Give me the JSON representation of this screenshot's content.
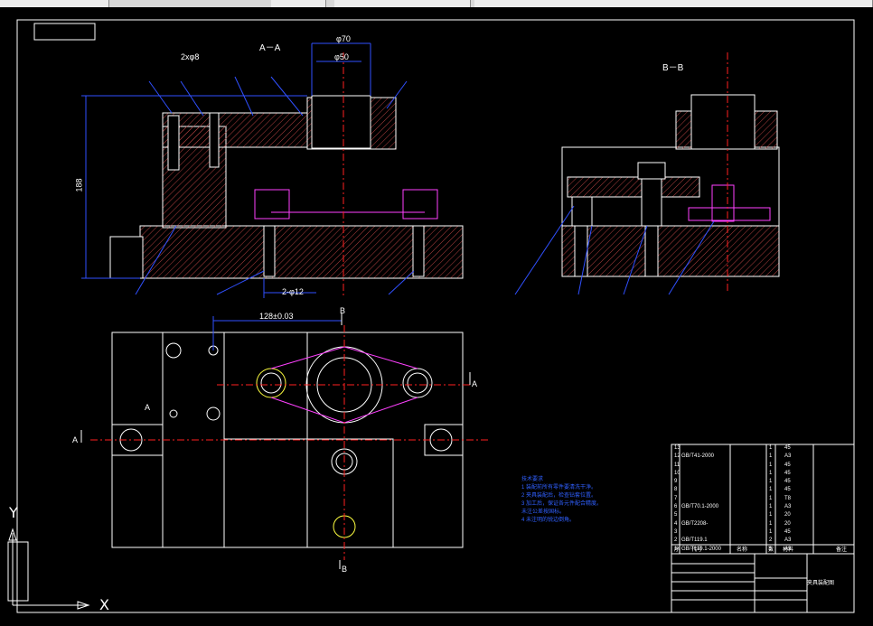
{
  "toolbar": {
    "present": true
  },
  "drawing": {
    "section_AA_label": "A－A",
    "section_BB_label": "B－B",
    "dim_phi70": "φ70",
    "dim_phi50": "φ50",
    "dim_holes": "2xφ8",
    "dim_height": "188",
    "dim_bottom": "2-φ12",
    "dim_spacing": "128±0.03",
    "mark_B_top": "B",
    "mark_B_bottom": "B",
    "mark_A_left": "A",
    "mark_A_right": "A",
    "mark_A_small": "A",
    "ucs_x": "X",
    "ucs_y": "Y"
  },
  "tech_notes": [
    "技术要求",
    "1  装配前所有零件要清洗干净。",
    "2  夹具装配后，检查钻套位置。",
    "3  加工后，保证各元件配合精度。",
    "   未注公差按国标。",
    "4  未注明的锐边倒角。"
  ],
  "parts_list": [
    {
      "no": "13",
      "code": "",
      "name": "",
      "qty": "1",
      "material": "45"
    },
    {
      "no": "12",
      "code": "GB/T41-2000",
      "name": "",
      "qty": "1",
      "material": "A3"
    },
    {
      "no": "11",
      "code": "",
      "name": "",
      "qty": "1",
      "material": "45"
    },
    {
      "no": "10",
      "code": "",
      "name": "",
      "qty": "1",
      "material": "45"
    },
    {
      "no": "9",
      "code": "",
      "name": "",
      "qty": "1",
      "material": "45"
    },
    {
      "no": "8",
      "code": "",
      "name": "",
      "qty": "1",
      "material": "45"
    },
    {
      "no": "7",
      "code": "",
      "name": "",
      "qty": "1",
      "material": "T8"
    },
    {
      "no": "6",
      "code": "GB/T70.1-2000",
      "name": "",
      "qty": "1",
      "material": "A3"
    },
    {
      "no": "5",
      "code": "",
      "name": "",
      "qty": "1",
      "material": "20"
    },
    {
      "no": "4",
      "code": "GB/T2208-",
      "name": "",
      "qty": "1",
      "material": "20"
    },
    {
      "no": "3",
      "code": "",
      "name": "",
      "qty": "1",
      "material": "45"
    },
    {
      "no": "2",
      "code": "GB/T119.1",
      "name": "",
      "qty": "2",
      "material": "A3"
    },
    {
      "no": "1",
      "code": "GB/T119.1-2000",
      "name": "",
      "qty": "1",
      "material": "A3"
    }
  ],
  "parts_header": {
    "no": "序",
    "code": "代号",
    "name": "名称",
    "qty": "数",
    "material": "材料",
    "note": "备注"
  },
  "title_block": {
    "name": "夹具装配图"
  },
  "colors": {
    "background": "#000000",
    "line": "#ffffff",
    "hatch": "#b04040",
    "dim": "#3050ff",
    "magenta": "#ff40ff",
    "yellow": "#ffff40"
  }
}
